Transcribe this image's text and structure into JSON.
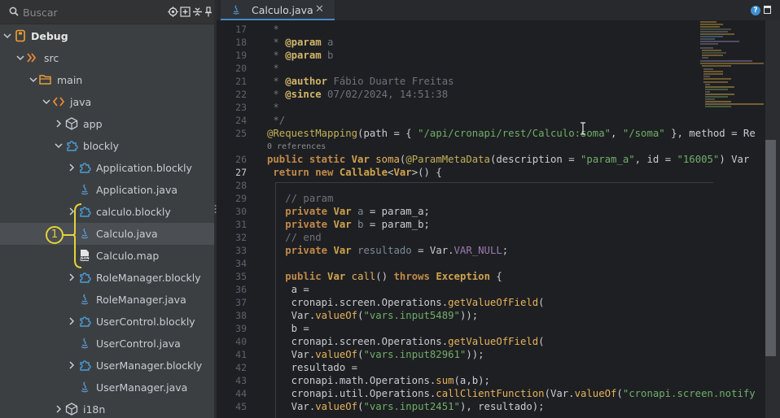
{
  "sidebar": {
    "search_placeholder": "Buscar",
    "tree": [
      {
        "label": "Debug",
        "bold": true
      },
      {
        "label": "src"
      },
      {
        "label": "main"
      },
      {
        "label": "java"
      },
      {
        "label": "app"
      },
      {
        "label": "blockly"
      },
      {
        "label": "Application.blockly"
      },
      {
        "label": "Application.java"
      },
      {
        "label": "calculo.blockly"
      },
      {
        "label": "Calculo.java",
        "selected": true
      },
      {
        "label": "Calculo.map"
      },
      {
        "label": "RoleManager.blockly"
      },
      {
        "label": "RoleManager.java"
      },
      {
        "label": "UserControl.blockly"
      },
      {
        "label": "UserControl.java"
      },
      {
        "label": "UserManager.blockly"
      },
      {
        "label": "UserManager.java"
      },
      {
        "label": "i18n"
      }
    ],
    "callout_number": "1"
  },
  "editor": {
    "tab_title": "Calculo.java",
    "tab_close": "✕",
    "help_icon": "?",
    "line_numbers": [
      "17",
      "18",
      "19",
      "20",
      "21",
      "22",
      "23",
      "24",
      "25",
      "26",
      "27",
      "28",
      "29",
      "30",
      "31",
      "32",
      "33",
      "34",
      "35",
      "36",
      "37",
      "38",
      "39",
      "40",
      "41",
      "42",
      "43",
      "44",
      "45"
    ],
    "current_line": "27",
    "references_hint": "0 references"
  },
  "colors": {
    "accent": "#4a88c7",
    "callout": "#e3d33a",
    "sidebar_bg": "#3c3f41",
    "editor_bg": "#1e1f22"
  }
}
